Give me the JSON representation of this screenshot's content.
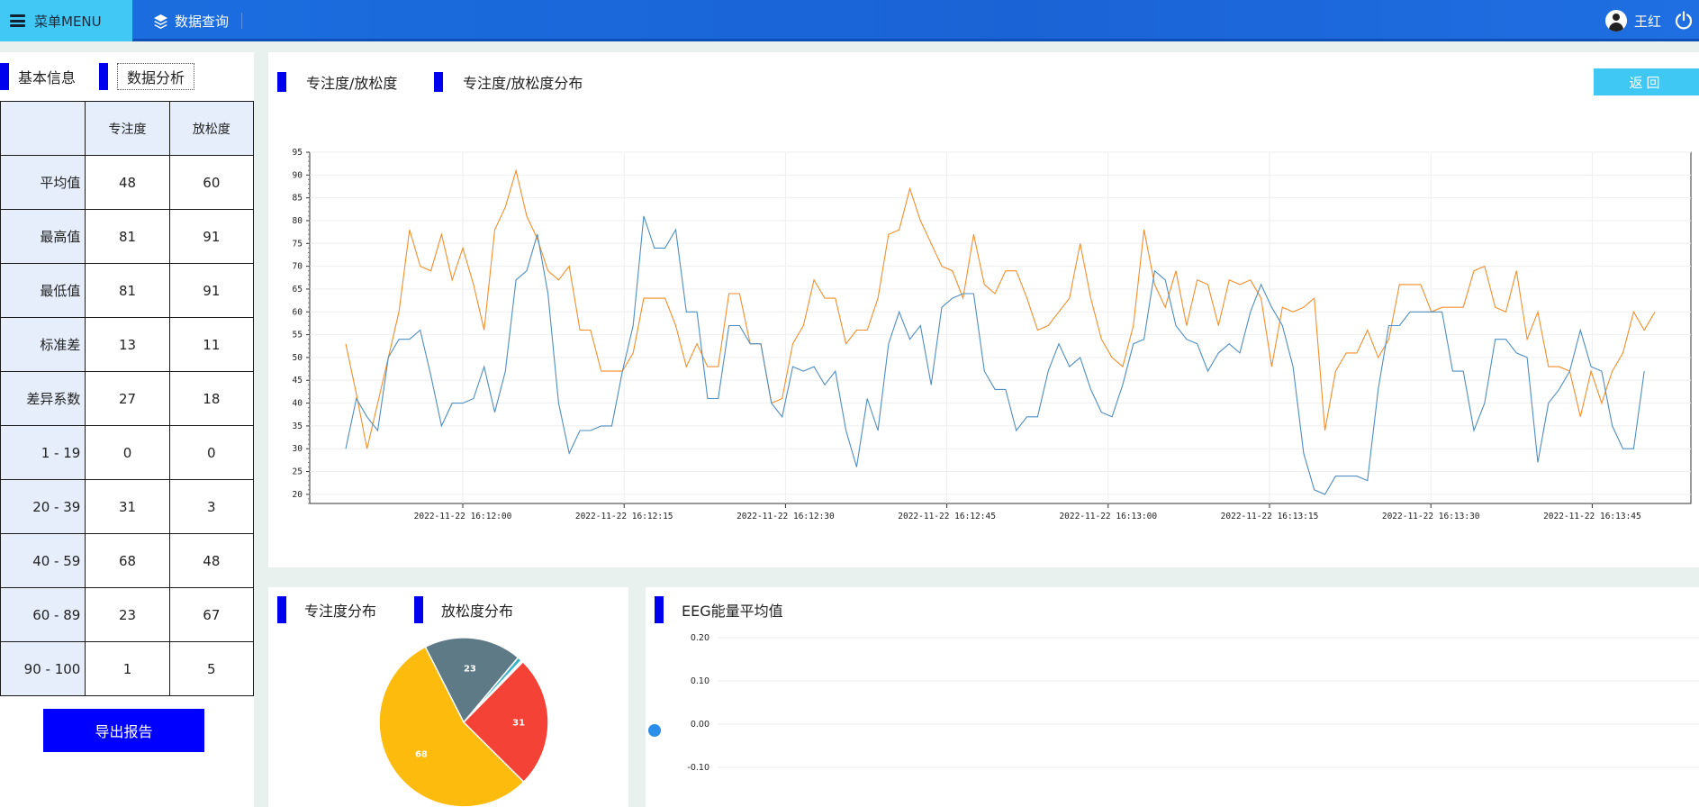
{
  "header": {
    "menu_label": "菜单MENU",
    "nav_query": "数据查询",
    "user_name": "王红"
  },
  "left_tabs": {
    "basic": "基本信息",
    "analysis": "数据分析"
  },
  "stats_table": {
    "columns": [
      "",
      "专注度",
      "放松度"
    ],
    "rows": [
      {
        "label": "平均值",
        "focus": "48",
        "relax": "60"
      },
      {
        "label": "最高值",
        "focus": "81",
        "relax": "91"
      },
      {
        "label": "最低值",
        "focus": "81",
        "relax": "91"
      },
      {
        "label": "标准差",
        "focus": "13",
        "relax": "11"
      },
      {
        "label": "差异系数",
        "focus": "27",
        "relax": "18"
      },
      {
        "label": "1 - 19",
        "focus": "0",
        "relax": "0"
      },
      {
        "label": "20 - 39",
        "focus": "31",
        "relax": "3"
      },
      {
        "label": "40 - 59",
        "focus": "68",
        "relax": "48"
      },
      {
        "label": "60 - 89",
        "focus": "23",
        "relax": "67"
      },
      {
        "label": "90 - 100",
        "focus": "1",
        "relax": "5"
      }
    ]
  },
  "export_label": "导出报告",
  "main_tabs": {
    "line": "专注度/放松度",
    "dist": "专注度/放松度分布",
    "back": "返回"
  },
  "pie_tabs": {
    "focus": "专注度分布",
    "relax": "放松度分布"
  },
  "eeg_title": "EEG能量平均值",
  "chart_data": [
    {
      "type": "line",
      "ylim": [
        18,
        95
      ],
      "yticks": [
        20,
        25,
        30,
        35,
        40,
        45,
        50,
        55,
        60,
        65,
        70,
        75,
        80,
        85,
        90,
        95
      ],
      "xticks": [
        "2022-11-22 16:12:00",
        "2022-11-22 16:12:15",
        "2022-11-22 16:12:30",
        "2022-11-22 16:12:45",
        "2022-11-22 16:13:00",
        "2022-11-22 16:13:15",
        "2022-11-22 16:13:30",
        "2022-11-22 16:13:45"
      ],
      "series": [
        {
          "color": "#f28e2b",
          "values": [
            53,
            42,
            30,
            40,
            50,
            60,
            78,
            70,
            69,
            77,
            67,
            74,
            66,
            56,
            78,
            83,
            91,
            81,
            76,
            69,
            67,
            70,
            56,
            56,
            47,
            47,
            47,
            51,
            63,
            63,
            63,
            57,
            48,
            53,
            48,
            48,
            64,
            64,
            53,
            53,
            40,
            41,
            53,
            57,
            67,
            63,
            63,
            53,
            56,
            56,
            63,
            77,
            78,
            87,
            80,
            75,
            70,
            69,
            63,
            77,
            66,
            64,
            69,
            69,
            63,
            56,
            57,
            60,
            63,
            75,
            63,
            54,
            50,
            48,
            57,
            78,
            66,
            61,
            69,
            57,
            67,
            66,
            57,
            67,
            66,
            67,
            63,
            48,
            61,
            60,
            61,
            63,
            34,
            47,
            51,
            51,
            56,
            50,
            54,
            66,
            66,
            66,
            60,
            61,
            61,
            61,
            69,
            70,
            61,
            60,
            69,
            54,
            60,
            48,
            48,
            47,
            37,
            47,
            40,
            47,
            51,
            60,
            56,
            60
          ]
        },
        {
          "color": "#4e8ec2",
          "values": [
            30,
            41,
            37,
            34,
            50,
            54,
            54,
            56,
            46,
            35,
            40,
            40,
            41,
            48,
            38,
            47,
            67,
            69,
            77,
            64,
            40,
            29,
            34,
            34,
            35,
            35,
            47,
            57,
            81,
            74,
            74,
            78,
            60,
            60,
            41,
            41,
            57,
            57,
            53,
            53,
            40,
            37,
            48,
            47,
            48,
            44,
            47,
            34,
            26,
            41,
            34,
            53,
            60,
            54,
            57,
            44,
            61,
            63,
            64,
            64,
            47,
            43,
            43,
            34,
            37,
            37,
            47,
            53,
            48,
            50,
            43,
            38,
            37,
            44,
            53,
            54,
            69,
            67,
            57,
            54,
            53,
            47,
            51,
            53,
            51,
            60,
            66,
            61,
            57,
            48,
            29,
            21,
            20,
            24,
            24,
            24,
            23,
            43,
            57,
            57,
            60,
            60,
            60,
            60,
            47,
            47,
            34,
            40,
            54,
            54,
            51,
            50,
            27,
            40,
            43,
            47,
            56,
            48,
            47,
            35,
            30,
            30,
            47
          ]
        }
      ]
    },
    {
      "type": "pie",
      "slices": [
        {
          "label": "68",
          "value": 68,
          "color": "#fdbb0e"
        },
        {
          "label": "23",
          "value": 23,
          "color": "#5f7a87"
        },
        {
          "label": "",
          "value": 1,
          "color": "#3ab4c8"
        },
        {
          "label": "",
          "value": 0.5,
          "color": "#ffffff"
        },
        {
          "label": "31",
          "value": 31,
          "color": "#f44336"
        }
      ]
    },
    {
      "type": "line",
      "ylim": [
        -0.1,
        0.2
      ],
      "yticks": [
        "0.20",
        "0.10",
        "0.00",
        "-0.10"
      ],
      "values": []
    }
  ]
}
